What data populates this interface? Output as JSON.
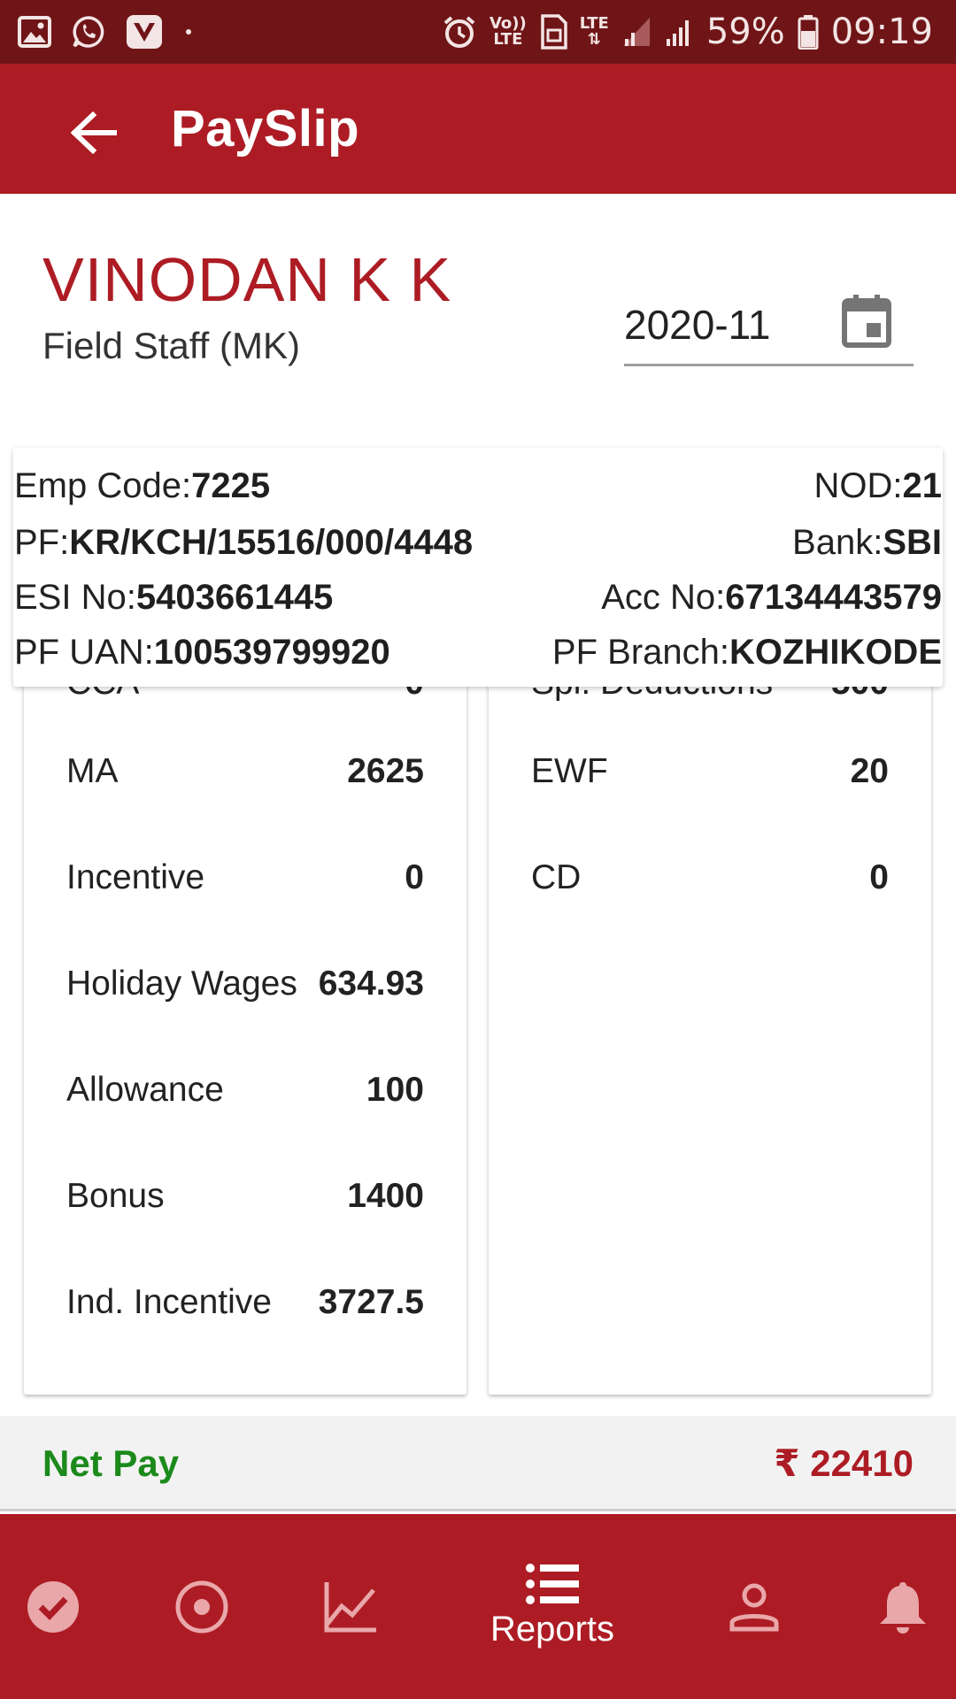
{
  "status_bar": {
    "battery": "59%",
    "time": "09:19",
    "volte_top": "Vo))",
    "volte_bottom": "LTE",
    "lte_label": "LTE",
    "icons": [
      "gallery-icon",
      "whatsapp-icon",
      "vi-icon",
      "dot-icon",
      "alarm-icon",
      "volte-icon",
      "hd-icon",
      "lte-icon",
      "signal-icon",
      "signal-icon",
      "battery-icon"
    ]
  },
  "app_bar": {
    "title": "PaySlip",
    "back_icon": "arrow-back-icon",
    "color": "#ad1c24"
  },
  "employee": {
    "name": "VINODAN K K",
    "role": "Field Staff (MK)"
  },
  "month_picker": {
    "value": "2020-11",
    "icon": "calendar-icon"
  },
  "info": {
    "emp_code_label": "Emp Code:",
    "emp_code": "7225",
    "nod_label": "NOD:",
    "nod": "21",
    "pf_label": "PF:",
    "pf": "KR/KCH/15516/000/4448",
    "bank_label": "Bank:",
    "bank": "SBI",
    "esi_label": "ESI No:",
    "esi": "5403661445",
    "acc_label": "Acc No:",
    "acc": "67134443579",
    "uan_label": "PF UAN:",
    "uan": "100539799920",
    "branch_label": "PF Branch:",
    "branch": "KOZHIKODE"
  },
  "earnings": [
    {
      "label": "CCA",
      "value": "0"
    },
    {
      "label": "MA",
      "value": "2625"
    },
    {
      "label": "Incentive",
      "value": "0"
    },
    {
      "label": "Holiday Wages",
      "value": "634.93"
    },
    {
      "label": "Allowance",
      "value": "100"
    },
    {
      "label": "Bonus",
      "value": "1400"
    },
    {
      "label": "Ind. Incentive",
      "value": "3727.5"
    }
  ],
  "deductions": [
    {
      "label": "Spl. Deductions",
      "value": "500"
    },
    {
      "label": "EWF",
      "value": "20"
    },
    {
      "label": "CD",
      "value": "0"
    }
  ],
  "net_pay": {
    "label": "Net Pay",
    "value": "₹ 22410",
    "label_color": "#1b8a1b",
    "value_color": "#ad1c24"
  },
  "bottom_nav": {
    "items": [
      {
        "icon": "check-circle-icon",
        "label": ""
      },
      {
        "icon": "radio-target-icon",
        "label": ""
      },
      {
        "icon": "trending-chart-icon",
        "label": ""
      },
      {
        "icon": "list-icon",
        "label": "Reports"
      },
      {
        "icon": "person-icon",
        "label": ""
      },
      {
        "icon": "bell-icon",
        "label": ""
      }
    ]
  }
}
